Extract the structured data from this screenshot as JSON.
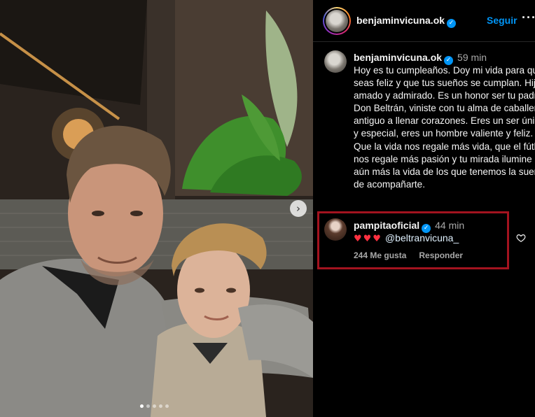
{
  "header": {
    "username": "benjaminvicuna.ok",
    "verified_mark": "✓",
    "follow_label": "Seguir",
    "more_label": "···"
  },
  "photo": {
    "carousel_next_label": "›",
    "dots": [
      true,
      false,
      false,
      false,
      false
    ]
  },
  "caption": {
    "username": "benjaminvicuna.ok",
    "time": "59 min",
    "text": "Hoy es tu cumpleaños. Doy mi vida para que seas feliz y que tus sueños se cumplan. Hijo amado y admirado. Es un honor ser tu padre. Don Beltrán, viniste con tu alma de caballero antiguo a llenar corazones. Eres un ser único y especial, eres un hombre valiente y feliz. Que la vida nos regale más vida, que el fútbol nos regale más pasión y tu mirada ilumine aún más la vida de los que tenemos la suerte de acompañarte."
  },
  "comment": {
    "username": "pampitaoficial",
    "verified_mark": "✓",
    "time": "44 min",
    "hearts": "♥♥♥",
    "mention": "@beltranvicuna_",
    "likes": "244 Me gusta",
    "reply_label": "Responder"
  },
  "colors": {
    "link": "#0095f6",
    "highlight": "#a3131f",
    "heart": "#ff3040"
  },
  "icons": {
    "like": "heart-outline-icon",
    "verified": "verified-badge-icon",
    "more": "more-options-icon"
  }
}
